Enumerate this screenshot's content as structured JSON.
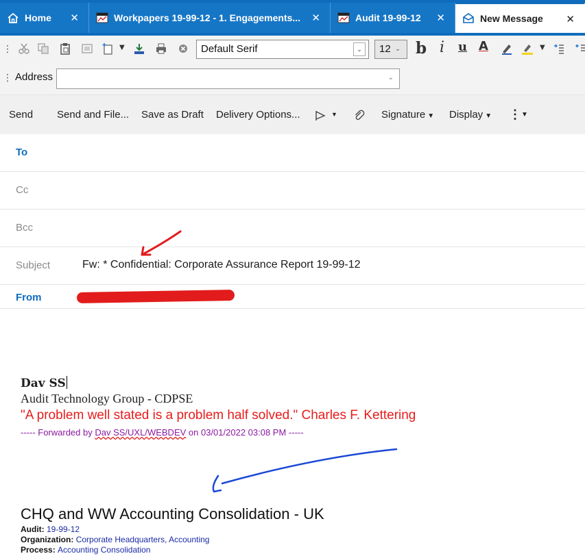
{
  "tabs": [
    {
      "label": "Home",
      "icon": "home-icon"
    },
    {
      "label": "Workpapers 19-99-12 - 1. Engagements...",
      "icon": "workpapers-icon"
    },
    {
      "label": "Audit 19-99-12",
      "icon": "audit-icon"
    },
    {
      "label": "New Message",
      "icon": "envelope-icon"
    }
  ],
  "tab_close_glyph": "✕",
  "format_toolbar": {
    "font": "Default Serif",
    "size": "12"
  },
  "address": {
    "label": "Address",
    "value": ""
  },
  "actions": {
    "send": "Send",
    "send_and_file": "Send and File...",
    "save_as_draft": "Save as Draft",
    "delivery_options": "Delivery Options...",
    "signature": "Signature",
    "display": "Display"
  },
  "headers": {
    "to": "To",
    "cc": "Cc",
    "bcc": "Bcc",
    "subject_label": "Subject",
    "subject_value": "Fw: * Confidential: Corporate Assurance Report 19-99-12",
    "from": "From"
  },
  "body": {
    "sig_name": "Dav SS",
    "sig_group": "Audit Technology Group - CDPSE",
    "quote": "\"A problem well stated is a problem half solved.\" Charles F. Kettering",
    "fwd_prefix": "----- Forwarded by ",
    "fwd_user": "Dav SS/UXL/WEBDEV",
    "fwd_suffix": " on 03/01/2022 03:08 PM -----",
    "doc_title": "CHQ and WW Accounting Consolidation - UK",
    "audit_label": "Audit",
    "audit_value": "19-99-12",
    "org_label": "Organization",
    "org_value": "Corporate Headquarters, Accounting",
    "process_label": "Process",
    "process_value": "Accounting Consolidation"
  },
  "colors": {
    "tab_bar": "#0f6cbd",
    "accent_blue": "#0f6cbd",
    "redaction": "#e21c1c",
    "quote_red": "#e81b1b",
    "forward_purple": "#8a1aa0"
  }
}
